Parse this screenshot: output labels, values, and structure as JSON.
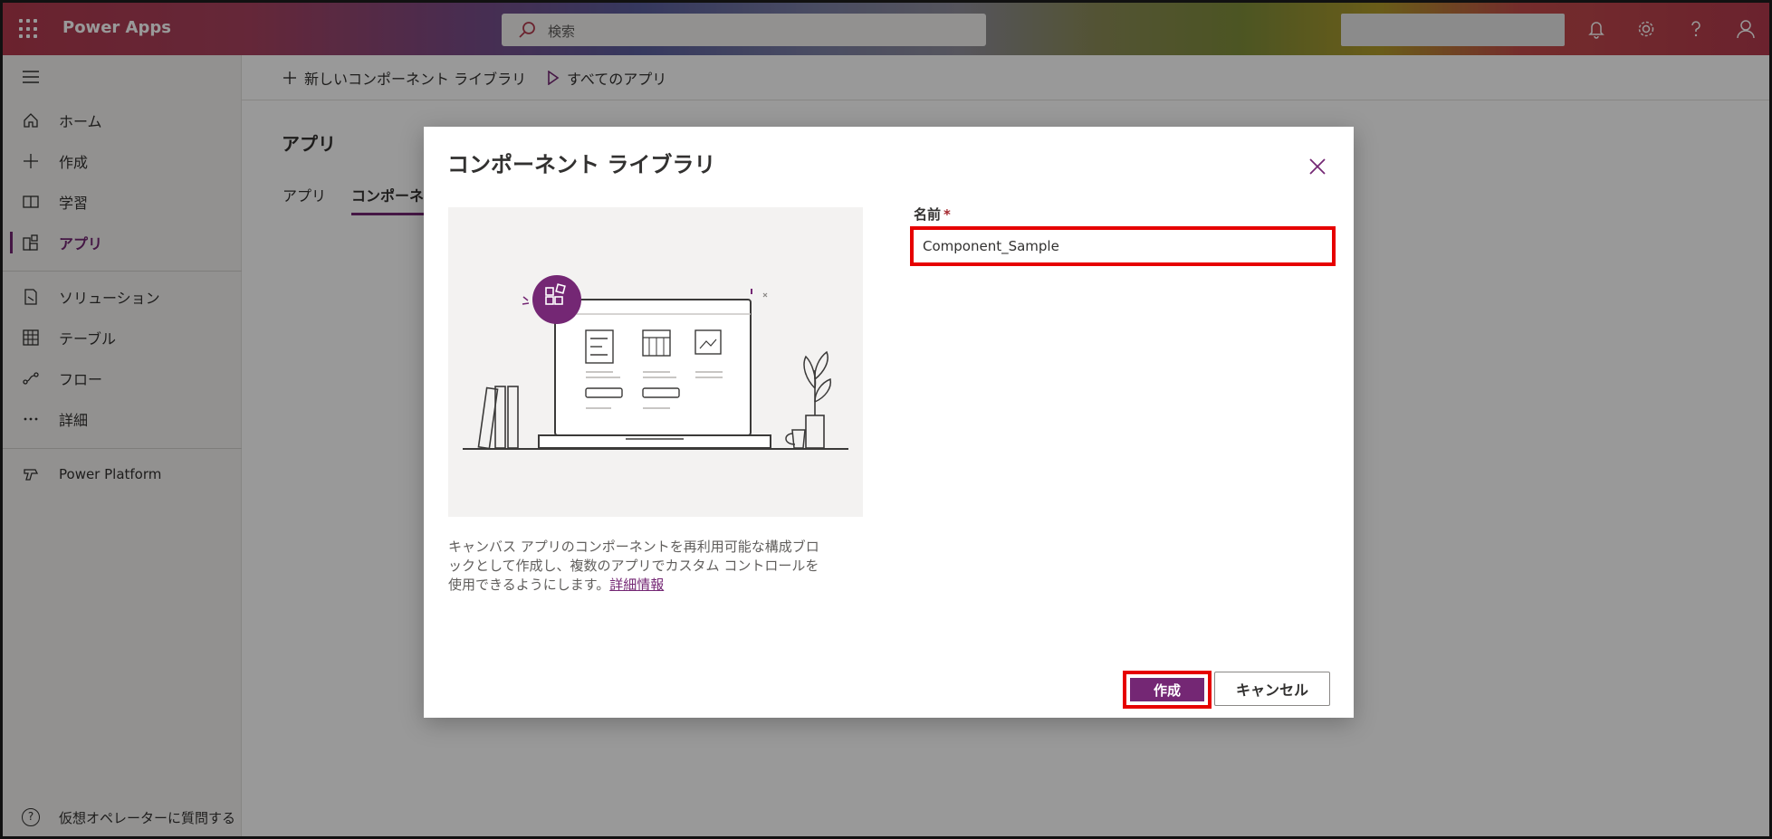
{
  "topbar": {
    "app_name": "Power Apps",
    "search_placeholder": "検索",
    "icons": [
      "waffle-icon",
      "search-icon",
      "bell-icon",
      "gear-icon",
      "help-icon",
      "user-icon"
    ]
  },
  "sidebar": {
    "items": [
      {
        "label": "ホーム",
        "icon": "home-icon"
      },
      {
        "label": "作成",
        "icon": "plus-icon"
      },
      {
        "label": "学習",
        "icon": "book-icon"
      },
      {
        "label": "アプリ",
        "icon": "apps-icon",
        "active": true
      },
      {
        "label": "ソリューション",
        "icon": "solution-icon"
      },
      {
        "label": "テーブル",
        "icon": "table-icon"
      },
      {
        "label": "フロー",
        "icon": "flow-icon"
      },
      {
        "label": "詳細",
        "icon": "more-icon"
      },
      {
        "label": "Power Platform",
        "icon": "power-platform-icon"
      }
    ],
    "help_label": "仮想オペレーターに質問する"
  },
  "cmdbar": {
    "new_library": "新しいコンポーネント ライブラリ",
    "all_apps": "すべてのアプリ"
  },
  "main": {
    "title": "アプリ",
    "tabs": [
      "アプリ",
      "コンポーネ"
    ]
  },
  "dialog": {
    "title": "コンポーネント ライブラリ",
    "description": "キャンバス アプリのコンポーネントを再利用可能な構成ブロックとして作成し、複数のアプリでカスタム コントロールを使用できるようにします。",
    "learn_more": "詳細情報",
    "name_label": "名前",
    "required_mark": "*",
    "name_value": "Component_Sample",
    "create_label": "作成",
    "cancel_label": "キャンセル"
  },
  "colors": {
    "accent": "#742774",
    "highlight": "#e60000"
  }
}
